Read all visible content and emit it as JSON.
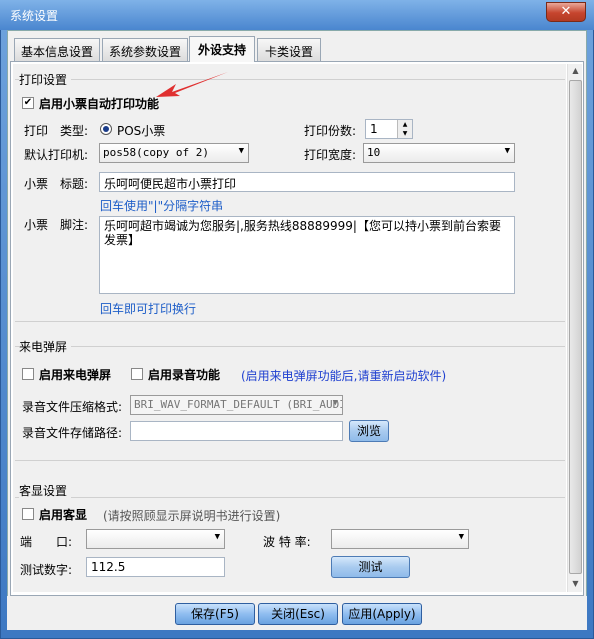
{
  "window": {
    "title": "系统设置",
    "close_label": "✕"
  },
  "tabs": [
    {
      "label": "基本信息设置"
    },
    {
      "label": "系统参数设置"
    },
    {
      "label": "外设支持"
    },
    {
      "label": "卡类设置"
    }
  ],
  "print_settings": {
    "group_title": "打印设置",
    "enable_ticket_print": {
      "label": "启用小票自动打印功能",
      "checked": true
    },
    "print_type_label": "打印　类型:",
    "print_type_option": "POS小票",
    "copies_label": "打印份数:",
    "copies_value": "1",
    "default_printer_label": "默认打印机:",
    "default_printer_value": "pos58(copy of 2)",
    "print_width_label": "打印宽度:",
    "print_width_value": "10",
    "ticket_title_label": "小票　标题:",
    "ticket_title_value": "乐呵呵便民超市小票打印",
    "title_hint": "回车使用\"|\"分隔字符串",
    "ticket_footer_label": "小票　脚注:",
    "ticket_footer_value": "乐呵呵超市竭诚为您服务|,服务热线88889999|【您可以持小票到前台索要发票】",
    "footer_hint": "回车即可打印换行"
  },
  "caller_popup": {
    "group_title": "来电弹屏",
    "enable_popup": {
      "label": "启用来电弹屏",
      "checked": false
    },
    "enable_recording": {
      "label": "启用录音功能",
      "checked": false
    },
    "restart_hint": "(启用来电弹屏功能后,请重新启动软件)",
    "compress_format_label": "录音文件压缩格式:",
    "compress_format_value": "BRI_WAV_FORMAT_DEFAULT (BRI_AUDI",
    "storage_path_label": "录音文件存储路径:",
    "storage_path_value": "",
    "browse_label": "浏览"
  },
  "customer_display": {
    "group_title": "客显设置",
    "enable_display": {
      "label": "启用客显",
      "checked": false
    },
    "display_hint": "(请按照顾显示屏说明书进行设置)",
    "port_label": "端　　口:",
    "port_value": "",
    "baud_label": "波 特 率:",
    "baud_value": "",
    "test_number_label": "测试数字:",
    "test_number_value": "112.5",
    "test_button_label": "测试"
  },
  "footer": {
    "save_label": "保存(F5)",
    "close_label": "关闭(Esc)",
    "apply_label": "应用(Apply)"
  },
  "colors": {
    "accent": "#1e5ec8",
    "hint_blue": "#1e3fd0",
    "close_red": "#c6452e",
    "arrow_red": "#e03030"
  }
}
